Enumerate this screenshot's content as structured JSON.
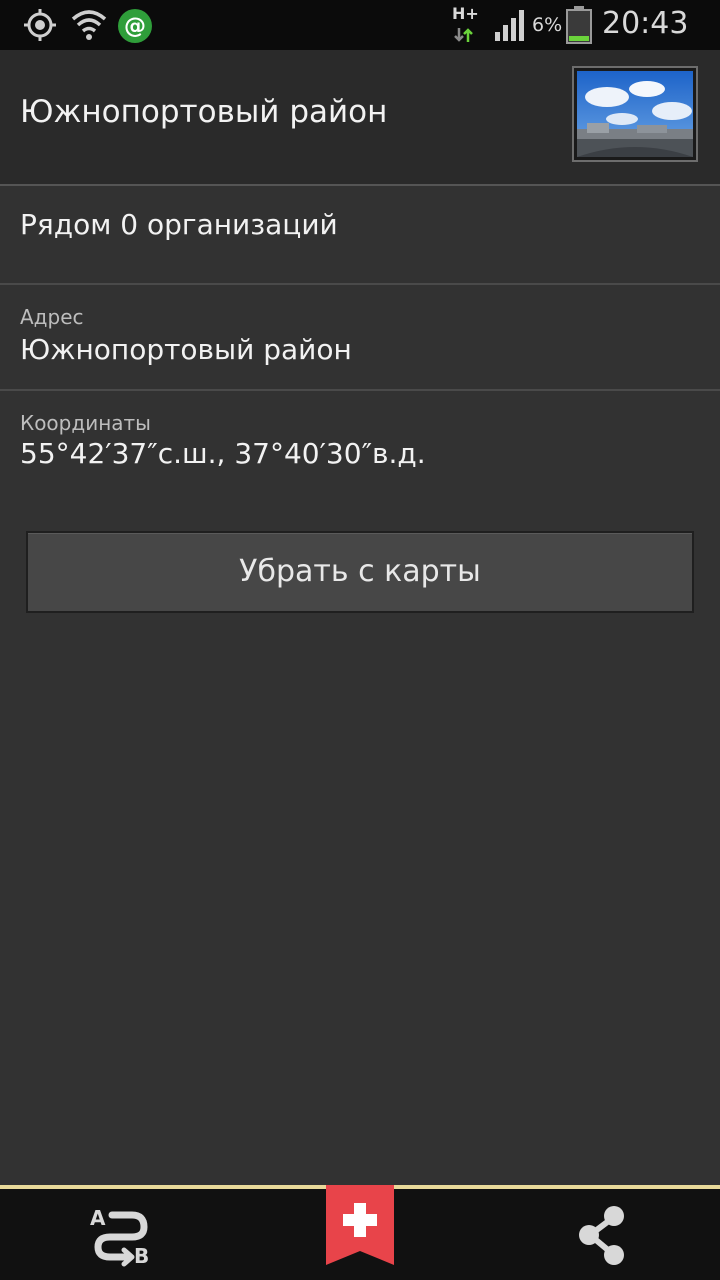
{
  "status_bar": {
    "network_type": "H+",
    "battery_percent": "6%",
    "time": "20:43",
    "icons": [
      "location-icon",
      "wifi-icon",
      "mail-agent-icon",
      "signal-icon",
      "battery-icon"
    ]
  },
  "header": {
    "title": "Южнопортовый район"
  },
  "nearby": {
    "text": "Рядом 0 организаций"
  },
  "address": {
    "label": "Адрес",
    "value": "Южнопортовый район"
  },
  "coordinates": {
    "label": "Координаты",
    "value": "55°42′37″с.ш., 37°40′30″в.д."
  },
  "remove_button": {
    "label": "Убрать с карты"
  },
  "bottom_bar": {
    "items": [
      "route-icon",
      "add-bookmark-icon",
      "share-icon"
    ],
    "accent_color": "#e8d99a",
    "bookmark_color": "#e8444a"
  }
}
